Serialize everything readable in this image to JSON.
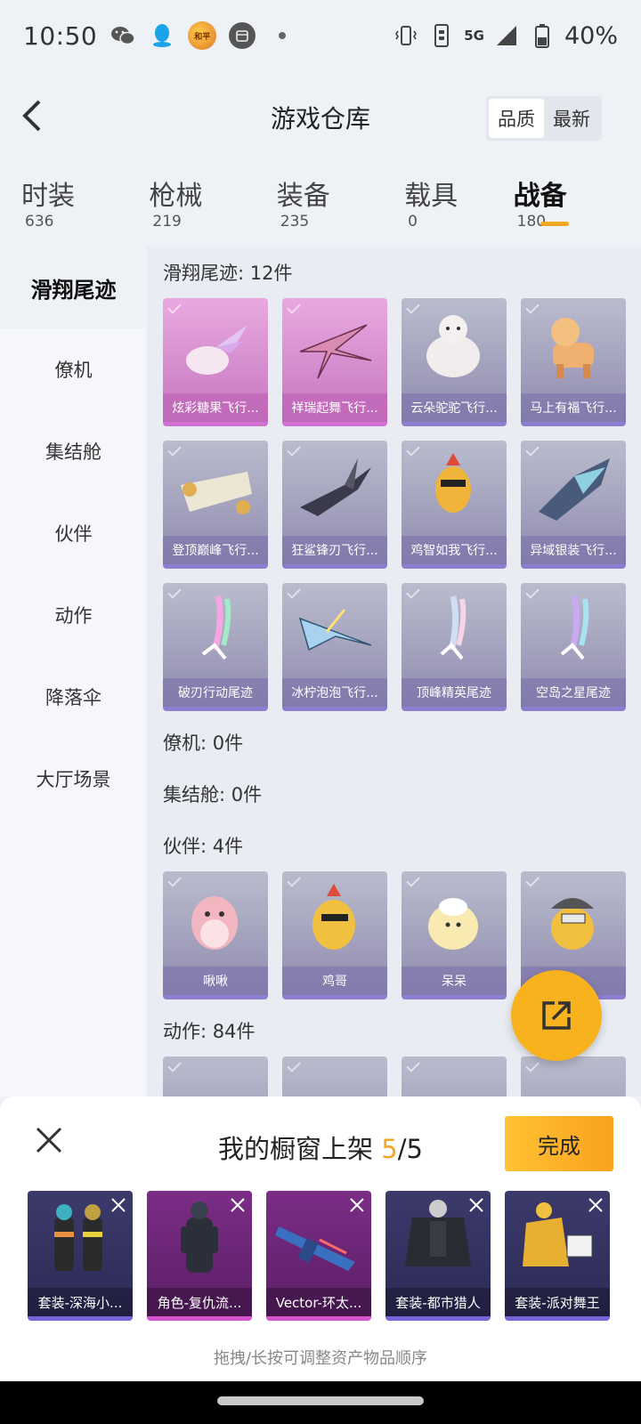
{
  "status_bar": {
    "time": "10:50",
    "battery": "40%",
    "network": "5G",
    "icons": [
      "wechat-icon",
      "qq-icon",
      "game-app-icon",
      "calendar-icon",
      "vibrate-icon",
      "sim-icon",
      "signal-icon",
      "battery-icon"
    ]
  },
  "header": {
    "title": "游戏仓库",
    "sort_options": [
      "品质",
      "最新"
    ],
    "sort_active": "品质"
  },
  "tabs": [
    {
      "label": "时装",
      "count": "636"
    },
    {
      "label": "枪械",
      "count": "219"
    },
    {
      "label": "装备",
      "count": "235"
    },
    {
      "label": "载具",
      "count": "0"
    },
    {
      "label": "战备",
      "count": "180",
      "active": true
    }
  ],
  "side_nav": [
    "滑翔尾迹",
    "僚机",
    "集结舱",
    "伙伴",
    "动作",
    "降落伞",
    "大厅场景"
  ],
  "sections": {
    "glide_trail": {
      "title": "滑翔尾迹: 12件",
      "items": [
        "炫彩糖果飞行...",
        "祥瑞起舞飞行...",
        "云朵驼驼飞行...",
        "马上有福飞行...",
        "登顶巅峰飞行...",
        "狂鲨锋刃飞行...",
        "鸡智如我飞行...",
        "异域银装飞行...",
        "破刃行动尾迹",
        "冰柠泡泡飞行...",
        "顶峰精英尾迹",
        "空岛之星尾迹"
      ]
    },
    "wingman": {
      "title": "僚机: 0件"
    },
    "rally_pod": {
      "title": "集结舱: 0件"
    },
    "partner": {
      "title": "伙伴: 4件",
      "items": [
        "啾啾",
        "鸡哥",
        "呆呆",
        ""
      ]
    },
    "emote": {
      "title": "动作: 84件"
    }
  },
  "showcase": {
    "title_prefix": "我的橱窗上架 ",
    "current": "5",
    "separator": "/",
    "total": "5",
    "done_label": "完成",
    "items": [
      "套装-深海小...",
      "角色-复仇流...",
      "Vector-环太...",
      "套装-都市猎人",
      "套装-派对舞王"
    ],
    "hint": "拖拽/长按可调整资产物品顺序"
  },
  "colors": {
    "accent": "#f5a623",
    "epic_pink": "#cf86c9",
    "rare_purple": "#9d9ab8"
  }
}
